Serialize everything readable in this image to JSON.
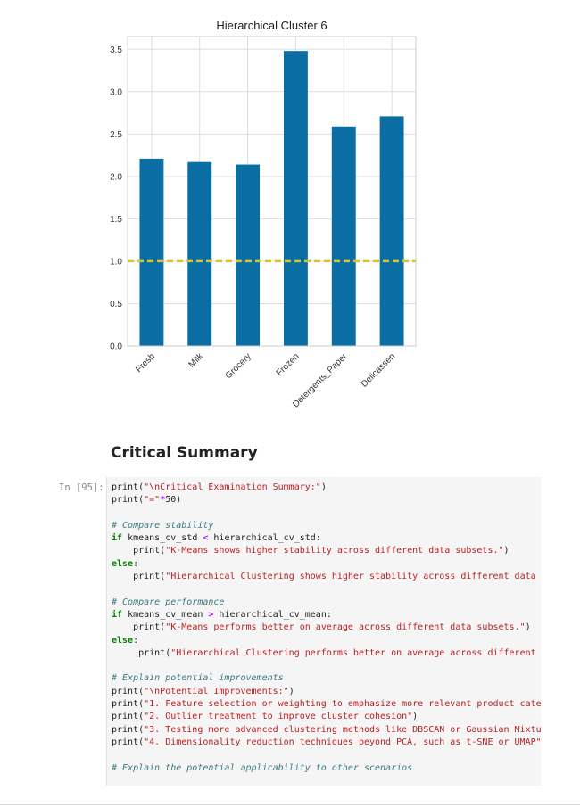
{
  "chart_data": {
    "type": "bar",
    "title": "Hierarchical Cluster 6",
    "categories": [
      "Fresh",
      "Milk",
      "Grocery",
      "Frozen",
      "Detergents_Paper",
      "Delicassen"
    ],
    "values": [
      2.21,
      2.17,
      2.14,
      3.48,
      2.59,
      2.71
    ],
    "ylim": [
      0,
      3.65
    ],
    "yticks": [
      0.0,
      0.5,
      1.0,
      1.5,
      2.0,
      2.5,
      3.0,
      3.5
    ],
    "ytick_labels": [
      "0.0",
      "0.5",
      "1.0",
      "1.5",
      "2.0",
      "2.5",
      "3.0",
      "3.5"
    ],
    "reference_line": 1.0,
    "bar_color": "#0a6ea4",
    "reference_line_color": "#d8c32a",
    "grid": true
  },
  "notebook": {
    "heading": "Critical Summary",
    "cell_prompt": "In [95]:",
    "code_lines": [
      [
        {
          "t": "print(",
          "c": ""
        },
        {
          "t": "\"\\nCritical Examination Summary:\"",
          "c": "st"
        },
        {
          "t": ")",
          "c": ""
        }
      ],
      [
        {
          "t": "print(",
          "c": ""
        },
        {
          "t": "\"=\"",
          "c": "st"
        },
        {
          "t": "*",
          "c": "op"
        },
        {
          "t": "50)",
          "c": ""
        }
      ],
      [],
      [
        {
          "t": "# Compare stability",
          "c": "cm"
        }
      ],
      [
        {
          "t": "if",
          "c": "kw"
        },
        {
          "t": " kmeans_cv_std ",
          "c": ""
        },
        {
          "t": "<",
          "c": "op"
        },
        {
          "t": " hierarchical_cv_std:",
          "c": ""
        }
      ],
      [
        {
          "t": "    print(",
          "c": ""
        },
        {
          "t": "\"K-Means shows higher stability across different data subsets.\"",
          "c": "st"
        },
        {
          "t": ")",
          "c": ""
        }
      ],
      [
        {
          "t": "else",
          "c": "kw"
        },
        {
          "t": ":",
          "c": ""
        }
      ],
      [
        {
          "t": "    print(",
          "c": ""
        },
        {
          "t": "\"Hierarchical Clustering shows higher stability across different data",
          "c": "st"
        }
      ],
      [],
      [
        {
          "t": "# Compare performance",
          "c": "cm"
        }
      ],
      [
        {
          "t": "if",
          "c": "kw"
        },
        {
          "t": " kmeans_cv_mean ",
          "c": ""
        },
        {
          "t": ">",
          "c": "op"
        },
        {
          "t": " hierarchical_cv_mean:",
          "c": ""
        }
      ],
      [
        {
          "t": "    print(",
          "c": ""
        },
        {
          "t": "\"K-Means performs better on average across different data subsets.\"",
          "c": "st"
        },
        {
          "t": ")",
          "c": ""
        }
      ],
      [
        {
          "t": "else",
          "c": "kw"
        },
        {
          "t": ":",
          "c": ""
        }
      ],
      [
        {
          "t": "     print(",
          "c": ""
        },
        {
          "t": "\"Hierarchical Clustering performs better on average across different",
          "c": "st"
        }
      ],
      [],
      [
        {
          "t": "# Explain potential improvements",
          "c": "cm"
        }
      ],
      [
        {
          "t": "print(",
          "c": ""
        },
        {
          "t": "\"\\nPotential Improvements:\"",
          "c": "st"
        },
        {
          "t": ")",
          "c": ""
        }
      ],
      [
        {
          "t": "print(",
          "c": ""
        },
        {
          "t": "\"1. Feature selection or weighting to emphasize more relevant product cate",
          "c": "st"
        }
      ],
      [
        {
          "t": "print(",
          "c": ""
        },
        {
          "t": "\"2. Outlier treatment to improve cluster cohesion\"",
          "c": "st"
        },
        {
          "t": ")",
          "c": ""
        }
      ],
      [
        {
          "t": "print(",
          "c": ""
        },
        {
          "t": "\"3. Testing more advanced clustering methods like DBSCAN or Gaussian Mixtu",
          "c": "st"
        }
      ],
      [
        {
          "t": "print(",
          "c": ""
        },
        {
          "t": "\"4. Dimensionality reduction techniques beyond PCA, such as t-SNE or UMAP\"",
          "c": "st"
        }
      ],
      [],
      [
        {
          "t": "# Explain the potential applicability to other scenarios",
          "c": "cm"
        }
      ]
    ]
  }
}
